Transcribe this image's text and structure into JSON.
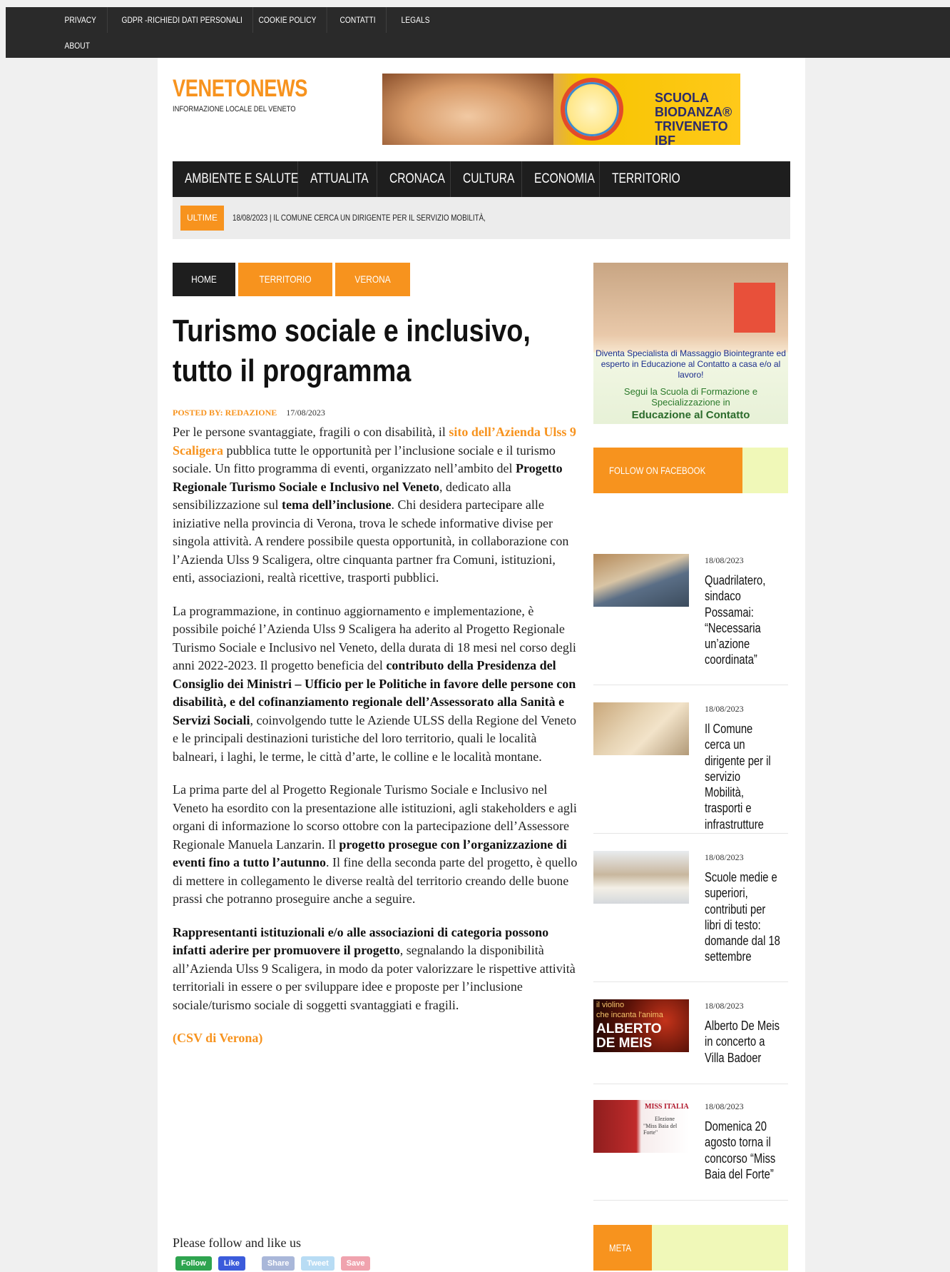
{
  "topbar": {
    "row1": [
      "PRIVACY",
      "GDPR -RICHIEDI DATI PERSONALI",
      "COOKIE POLICY",
      "CONTATTI",
      "LEGALS"
    ],
    "row2": [
      "ABOUT"
    ]
  },
  "site": {
    "title": "VENETONEWS",
    "tagline": "INFORMAZIONE LOCALE DEL VENETO"
  },
  "banner": {
    "line1": "SCUOLA",
    "line2": "BIODANZA®",
    "line3": "TRIVENETO IBF"
  },
  "mainnav": [
    "AMBIENTE E SALUTE",
    "ATTUALITA",
    "CRONACA",
    "CULTURA",
    "ECONOMIA",
    "TERRITORIO"
  ],
  "ticker": {
    "label": "ULTIME",
    "text": "18/08/2023  |  IL COMUNE CERCA UN DIRIGENTE PER IL SERVIZIO MOBILITÀ,"
  },
  "breadcrumb": [
    "HOME",
    "TERRITORIO",
    "VERONA"
  ],
  "article": {
    "title": "Turismo sociale e inclusivo, tutto il programma",
    "posted_by": "POSTED BY: REDAZIONE",
    "date": "17/08/2023",
    "p1_a": "Per le persone svantaggiate, fragili o con disabilità, il ",
    "p1_link": "sito dell’Azienda Ulss 9 Scaligera",
    "p1_b": " pubblica tutte le opportunità per l’inclusione sociale e il turismo sociale. Un fitto programma di eventi, organizzato nell’ambito del ",
    "p1_bold1": "Progetto Regionale Turismo Sociale e Inclusivo nel Veneto",
    "p1_c": ", dedicato alla sensibilizzazione sul ",
    "p1_bold2": "tema dell’inclusione",
    "p1_d": ". Chi desidera partecipare alle iniziative nella provincia di Verona, trova le schede informative divise per singola attività. A rendere possibile questa opportunità, in collaborazione con l’Azienda Ulss 9 Scaligera, oltre cinquanta partner fra Comuni, istituzioni, enti, associazioni, realtà ricettive, trasporti pubblici.",
    "p2_a": "La programmazione, in continuo aggiornamento e implementazione, è possibile poiché l’Azienda Ulss 9 Scaligera ha aderito al Progetto Regionale Turismo Sociale e Inclusivo nel Veneto, della durata di 18 mesi nel corso degli anni 2022-2023. Il progetto beneficia del ",
    "p2_bold": "contributo della Presidenza del Consiglio dei Ministri – Ufficio per le Politiche in favore delle persone con disabilità, e del cofinanziamento regionale dell’Assessorato alla Sanità e Servizi Sociali",
    "p2_b": ", coinvolgendo tutte le Aziende ULSS della Regione del Veneto e le principali destinazioni turistiche del loro territorio, quali le località balneari, i laghi, le terme, le città d’arte, le colline e le località montane.",
    "p3_a": "La prima parte del al Progetto Regionale Turismo Sociale e Inclusivo nel Veneto ha esordito con la presentazione alle istituzioni, agli stakeholders e agli organi di informazione lo scorso ottobre con la partecipazione dell’Assessore Regionale Manuela Lanzarin. Il ",
    "p3_bold": "progetto prosegue con l’organizzazione di eventi fino a tutto l’autunno",
    "p3_b": ". Il fine della seconda parte del progetto, è quello di mettere in collegamento le diverse realtà del territorio creando delle buone prassi che potranno proseguire anche a seguire.",
    "p4_bold": "Rappresentanti istituzionali e/o alle associazioni di categoria possono infatti aderire per promuovere il progetto",
    "p4_a": ", segnalando la disponibilità all’Azienda Ulss 9 Scaligera, in modo da poter valorizzare le rispettive attività territoriali in essere o per sviluppare idee e proposte per l’inclusione sociale/turismo sociale di soggetti svantaggiati e fragili.",
    "source": "(CSV di Verona)"
  },
  "share": {
    "title": "Please follow and like us",
    "buttons": [
      "Follow",
      "Like",
      "Share",
      "Tweet",
      "Save"
    ]
  },
  "sidebar": {
    "ad": {
      "line1": "Diventa Specialista di Massaggio Biointegrante ed esperto in Educazione al Contatto a casa e/o al lavoro!",
      "line2": "Segui la Scuola di Formazione e Specializzazione in",
      "line3": "Educazione al Contatto"
    },
    "facebook_label": "FOLLOW ON FACEBOOK",
    "meta_label": "META",
    "posts": [
      {
        "date": "18/08/2023",
        "title": "Quadrilatero, sindaco Possamai: “Necessaria un’azione coordinata”"
      },
      {
        "date": "18/08/2023",
        "title": "Il Comune cerca un dirigente per il servizio Mobilità, trasporti e infrastrutture"
      },
      {
        "date": "18/08/2023",
        "title": "Scuole medie e superiori, contributi per libri di testo: domande dal 18 settembre"
      },
      {
        "date": "18/08/2023",
        "title": "Alberto De Meis in concerto a Villa Badoer"
      },
      {
        "date": "18/08/2023",
        "title": "Domenica 20 agosto torna il concorso “Miss Baia del Forte”"
      }
    ],
    "thumb_texts": {
      "t4a": "il violino",
      "t4b": "che incanta l'anima",
      "t4c": "ALBERTO DE MEIS",
      "t5a": "MISS ITALIA",
      "t5b": "Elezione",
      "t5c": "\"Miss Baia del Forte\""
    }
  },
  "colors": {
    "accent": "#f7931e",
    "dark": "#1e1e1e",
    "topbar": "#2a2a2a"
  }
}
